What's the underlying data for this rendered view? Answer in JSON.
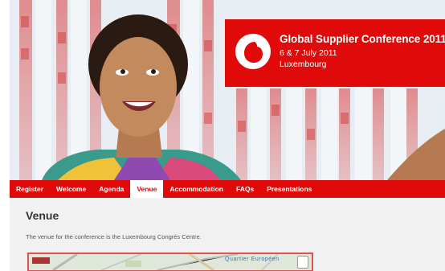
{
  "banner": {
    "title": "Global Supplier Conference 2011",
    "date": "6 & 7 July 2011",
    "place": "Luxembourg",
    "brand_color": "#e10a0a"
  },
  "nav": {
    "items": [
      {
        "label": "Register",
        "active": false
      },
      {
        "label": "Welcome",
        "active": false
      },
      {
        "label": "Agenda",
        "active": false
      },
      {
        "label": "Venue",
        "active": true
      },
      {
        "label": "Accommodation",
        "active": false
      },
      {
        "label": "FAQs",
        "active": false
      },
      {
        "label": "Presentations",
        "active": false
      }
    ]
  },
  "content": {
    "heading": "Venue",
    "intro": "The venue for the conference is the Luxembourg Congrès Centre.",
    "map_label": "Quartier Européen"
  },
  "icons": {
    "logo": "vodafone-logo-icon",
    "compass": "compass-icon"
  }
}
